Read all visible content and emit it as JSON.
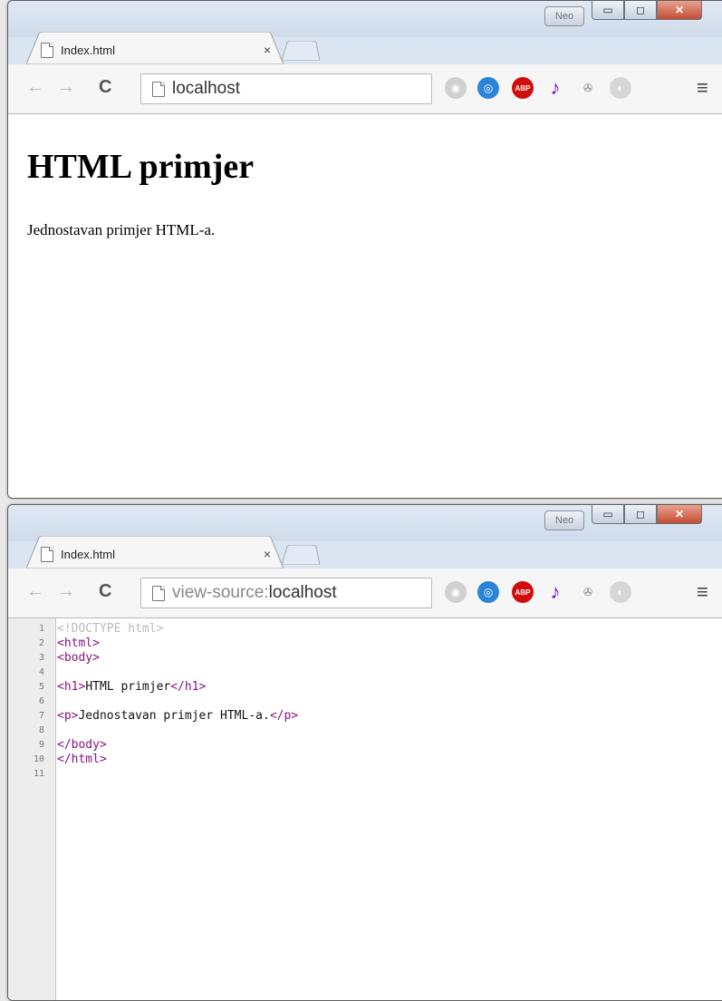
{
  "windows": [
    {
      "id": "rendered",
      "tab_title": "Index.html",
      "tab_close": "×",
      "profile_badge": "Neo",
      "url_prefix": "",
      "url_host": "localhost",
      "page": {
        "heading": "HTML primjer",
        "paragraph": "Jednostavan primjer HTML-a."
      }
    },
    {
      "id": "source",
      "tab_title": "Index.html",
      "tab_close": "×",
      "profile_badge": "Neo",
      "url_prefix": "view-source:",
      "url_host": "localhost",
      "source_lines": [
        {
          "n": "1",
          "parts": [
            {
              "t": "<!DOCTYPE html>",
              "c": "doc"
            }
          ]
        },
        {
          "n": "2",
          "parts": [
            {
              "t": "<html>",
              "c": "tag"
            }
          ]
        },
        {
          "n": "3",
          "parts": [
            {
              "t": "<body>",
              "c": "tag"
            }
          ]
        },
        {
          "n": "4",
          "parts": []
        },
        {
          "n": "5",
          "parts": [
            {
              "t": "<h1>",
              "c": "tag"
            },
            {
              "t": "HTML primjer",
              "c": "text"
            },
            {
              "t": "</h1>",
              "c": "tag"
            }
          ]
        },
        {
          "n": "6",
          "parts": []
        },
        {
          "n": "7",
          "parts": [
            {
              "t": "<p>",
              "c": "tag"
            },
            {
              "t": "Jednostavan primjer HTML-a.",
              "c": "text"
            },
            {
              "t": "</p>",
              "c": "tag"
            }
          ]
        },
        {
          "n": "8",
          "parts": []
        },
        {
          "n": "9",
          "parts": [
            {
              "t": "</body>",
              "c": "tag"
            }
          ]
        },
        {
          "n": "10",
          "parts": [
            {
              "t": "</html>",
              "c": "tag"
            }
          ]
        },
        {
          "n": "11",
          "parts": []
        }
      ]
    }
  ],
  "toolbar": {
    "back_glyph": "←",
    "forward_glyph": "→",
    "reload_glyph": "C",
    "menu_glyph": "≡",
    "extensions": [
      {
        "name": "shield-extension-icon",
        "glyph": "◉",
        "bg": "#d0d0d0",
        "fg": "#ffffff"
      },
      {
        "name": "blue-extension-icon",
        "glyph": "◎",
        "bg": "#2b84d8",
        "fg": "#ffffff"
      },
      {
        "name": "adblock-plus-icon",
        "glyph": "ABP",
        "bg": "#d10c0c",
        "fg": "#ffffff"
      },
      {
        "name": "music-note-icon",
        "glyph": "♪",
        "bg": "transparent",
        "fg": "#7a0fd1"
      },
      {
        "name": "film-reel-icon",
        "glyph": "✇",
        "bg": "transparent",
        "fg": "#777777"
      },
      {
        "name": "globe-icon",
        "glyph": "◐",
        "bg": "#d6d6d6",
        "fg": "#ffffff"
      }
    ]
  },
  "colors": {
    "tag": "#881280",
    "doctype": "#bbbbbb",
    "close_button": "#c44d32"
  }
}
